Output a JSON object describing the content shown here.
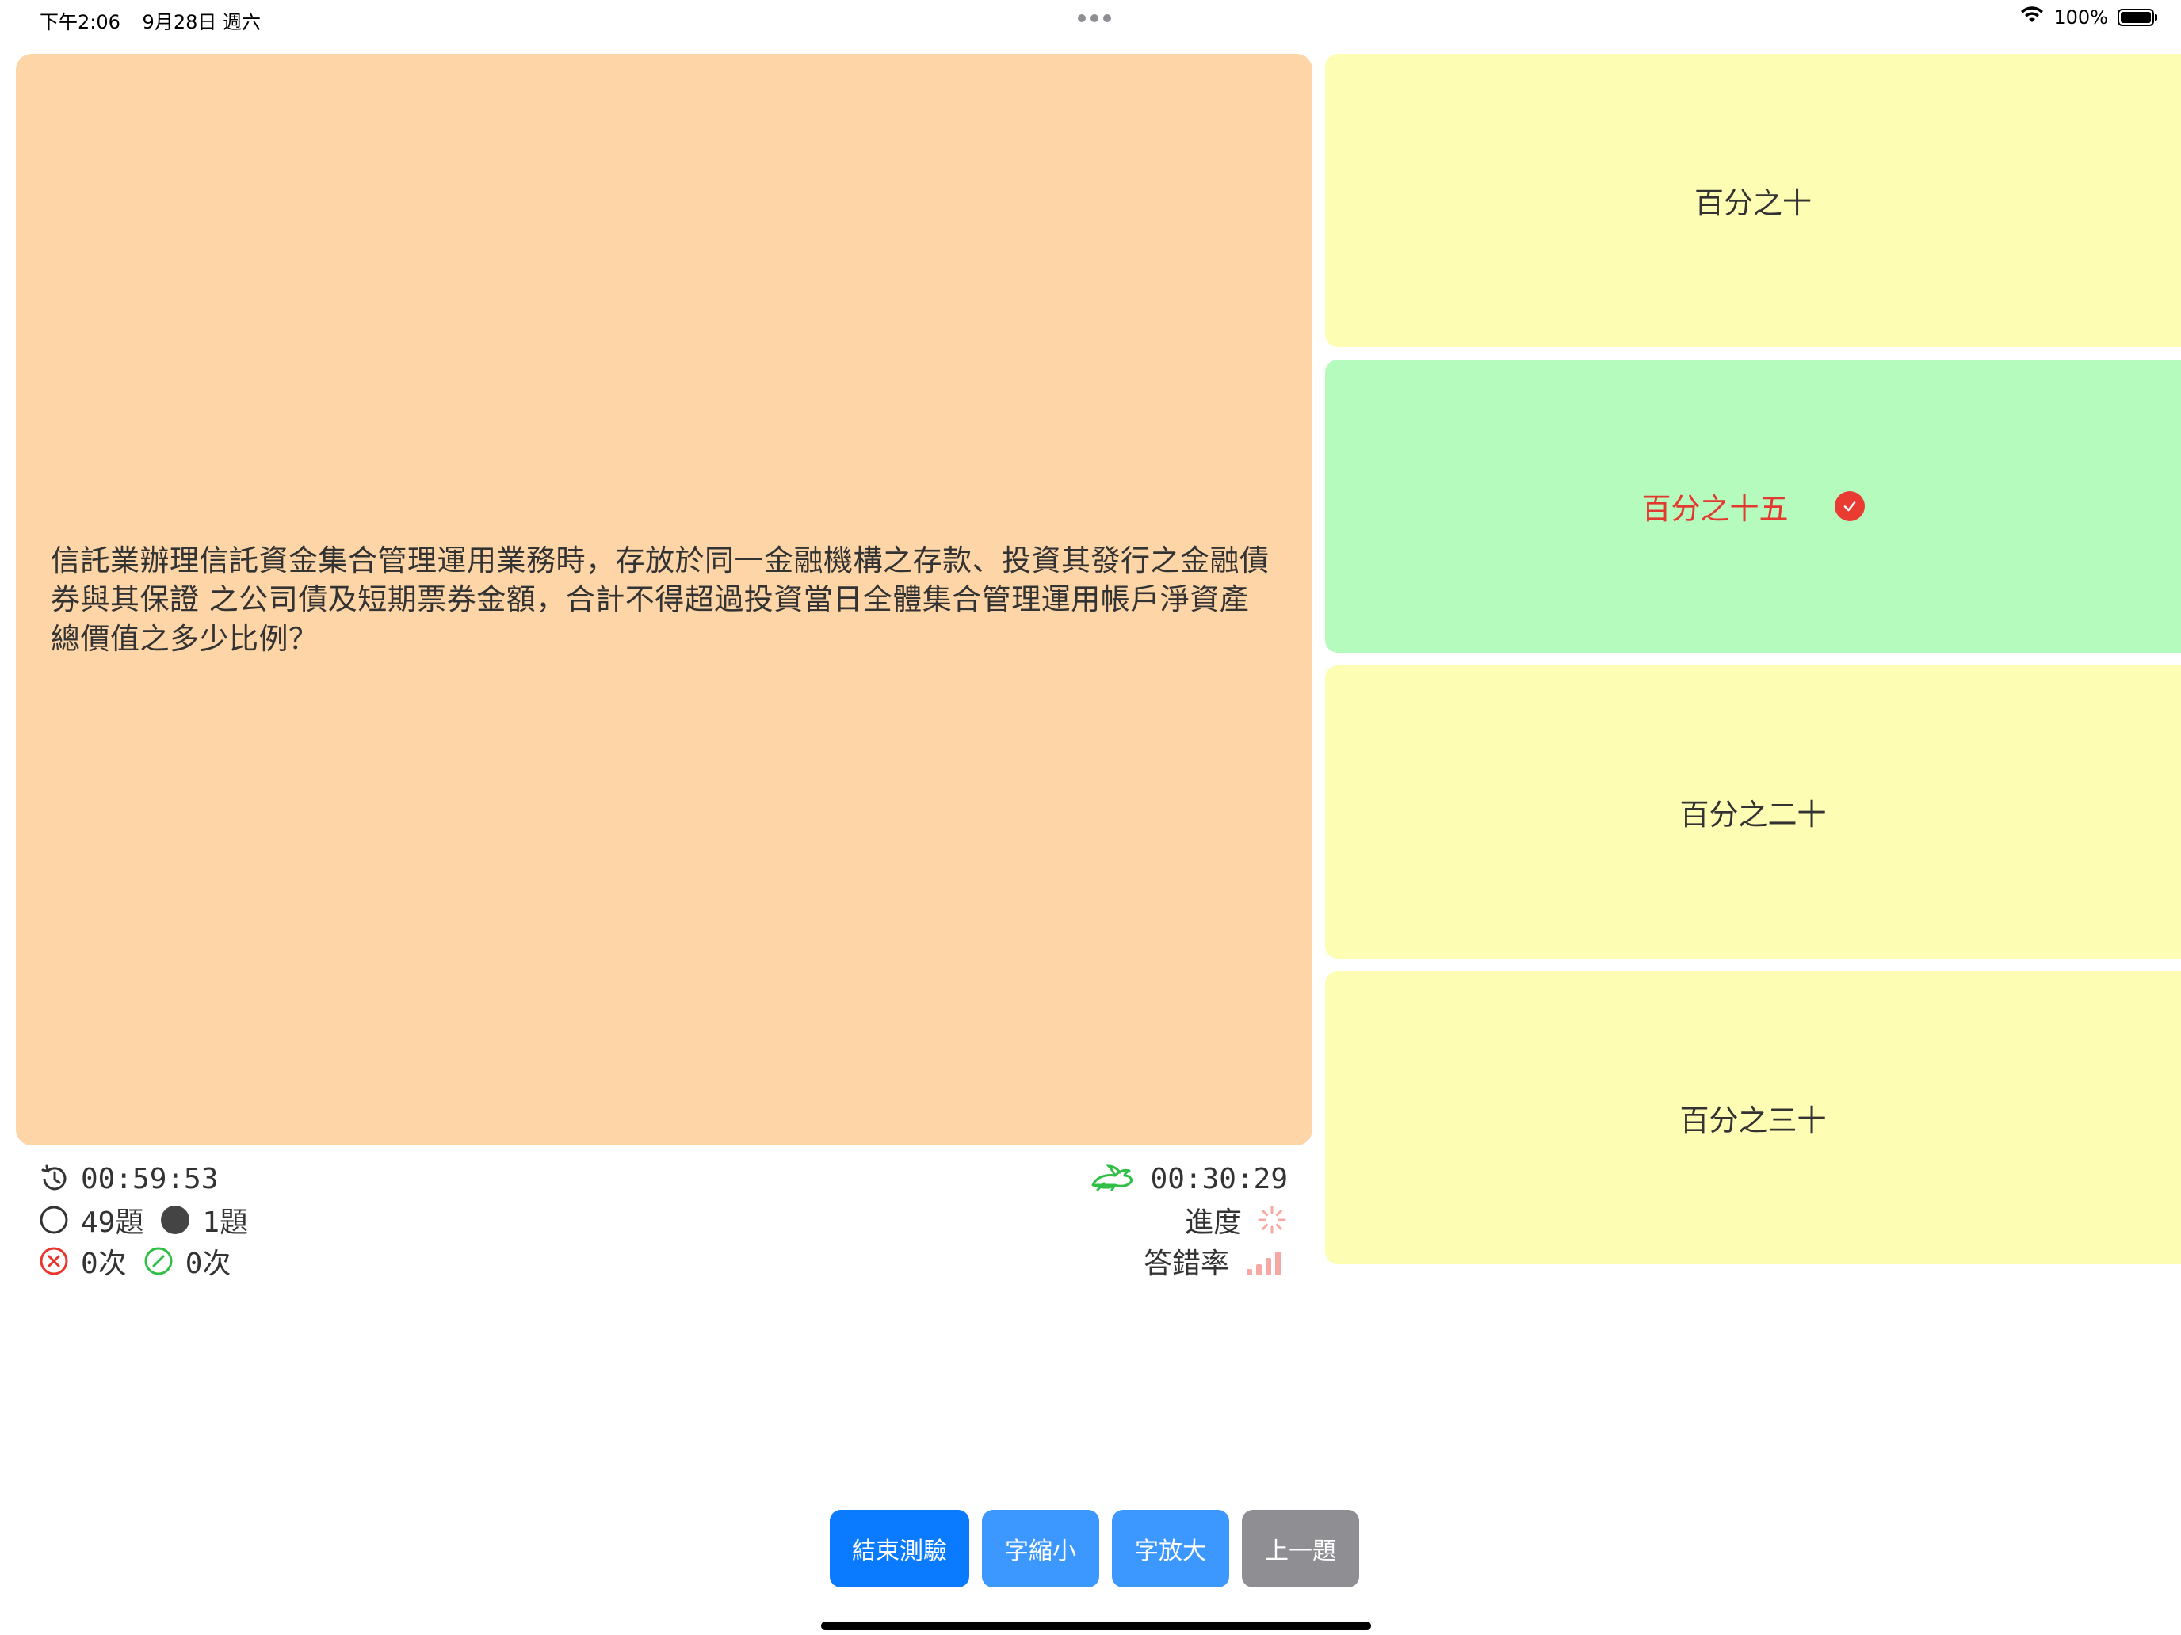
{
  "status_bar": {
    "time": "下午2:06",
    "date": "9月28日 週六",
    "battery": "100%"
  },
  "question": {
    "text": "信託業辦理信託資金集合管理運用業務時，存放於同一金融機構之存款、投資其發行之金融債券與其保證 之公司債及短期票券金額，合計不得超過投資當日全體集合管理運用帳戶淨資產總價值之多少比例？"
  },
  "options": [
    {
      "label": "百分之十",
      "state": "normal",
      "color": "#fdfdb4"
    },
    {
      "label": "百分之十五",
      "state": "correct",
      "color": "#b5fbbd"
    },
    {
      "label": "百分之二十",
      "state": "normal",
      "color": "#fdfdb4"
    },
    {
      "label": "百分之三十",
      "state": "normal",
      "color": "#fdfdb4"
    }
  ],
  "stats": {
    "total_time": "00:59:53",
    "remaining_count": "49題",
    "answered_count": "1題",
    "wrong_count": "0次",
    "right_count": "0次",
    "elapsed_time": "00:30:29",
    "progress_label": "進度",
    "error_rate_label": "答錯率"
  },
  "buttons": {
    "end": "結束測驗",
    "font_smaller": "字縮小",
    "font_larger": "字放大",
    "previous": "上一題"
  },
  "colors": {
    "question_bg": "#fdd5a6",
    "option_bg": "#fdfdb4",
    "correct_bg": "#b5fbbd",
    "correct_text": "#e23a2e",
    "primary_button": "#0a7aff",
    "secondary_button": "#3c98fe",
    "disabled_button": "#8e8e93"
  }
}
